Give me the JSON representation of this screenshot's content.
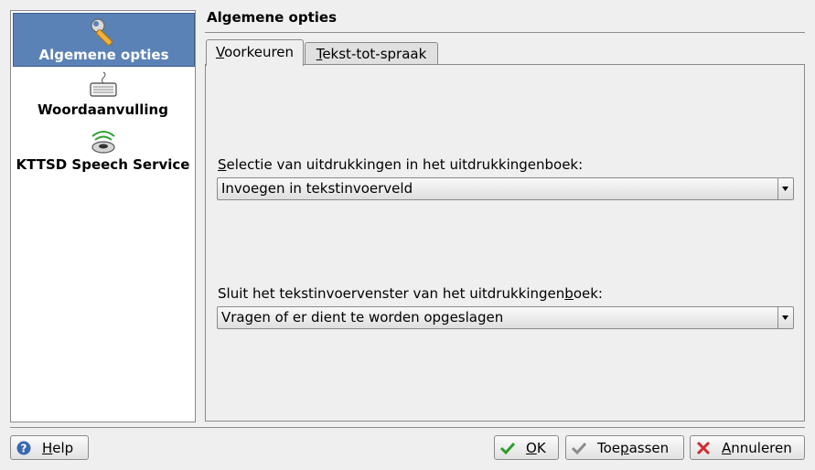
{
  "sidebar": {
    "items": [
      {
        "label": "Algemene opties",
        "icon": "wrench-icon",
        "selected": true
      },
      {
        "label": "Woordaanvulling",
        "icon": "keyboard-icon",
        "selected": false
      },
      {
        "label": "KTTSD Speech Service",
        "icon": "speaker-icon",
        "selected": false
      }
    ]
  },
  "header": {
    "title": "Algemene opties"
  },
  "tabs": [
    {
      "pre": "",
      "key": "V",
      "post": "oorkeuren",
      "active": true
    },
    {
      "pre": "",
      "key": "T",
      "post": "ekst-tot-spraak",
      "active": false
    }
  ],
  "fields": {
    "selection": {
      "label_pre": "",
      "label_key": "S",
      "label_post": "electie van uitdrukkingen in het uitdrukkingenboek:",
      "value": "Invoegen in tekstinvoerveld"
    },
    "close": {
      "label_pre": "Sluit het tekstinvoervenster van het uitdrukkingen",
      "label_key": "b",
      "label_post": "oek:",
      "value": "Vragen of er dient te worden opgeslagen"
    }
  },
  "buttons": {
    "help": {
      "pre": "",
      "key": "H",
      "post": "elp",
      "icon": "help-icon"
    },
    "ok": {
      "pre": "",
      "key": "O",
      "post": "K",
      "icon": "check-icon"
    },
    "apply": {
      "pre": "Toe",
      "key": "p",
      "post": "assen",
      "icon": "check-gray-icon"
    },
    "cancel": {
      "pre": "",
      "key": "A",
      "post": "nnuleren",
      "icon": "cancel-icon"
    }
  },
  "colors": {
    "selection": "#5b82b6",
    "ok_check": "#2e9d2e",
    "cancel_x": "#d42a2a",
    "help": "#3a67b5"
  }
}
